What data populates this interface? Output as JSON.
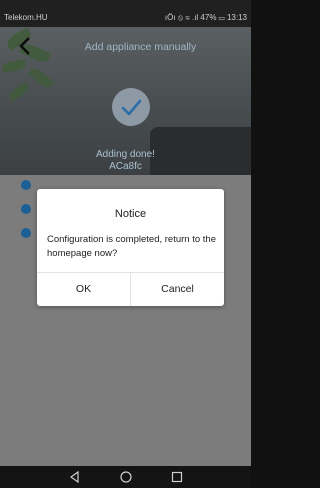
{
  "status_bar": {
    "carrier": "Telekom.HU",
    "right_text": "ıÖı ⦸ ≋ .ıl 47% ▭ 13:13"
  },
  "header": {
    "title": "Add appliance manually"
  },
  "result": {
    "message": "Adding done!",
    "device_name": "ACa8fc"
  },
  "dialog": {
    "title": "Notice",
    "message": "Configuration is completed, return to the homepage now?",
    "ok_label": "OK",
    "cancel_label": "Cancel"
  },
  "navbar": {
    "icons": [
      "back-triangle-icon",
      "home-circle-icon",
      "recents-square-icon"
    ]
  },
  "colors": {
    "accent": "#1a5f95",
    "overlay_content": "#7c7c7c"
  }
}
